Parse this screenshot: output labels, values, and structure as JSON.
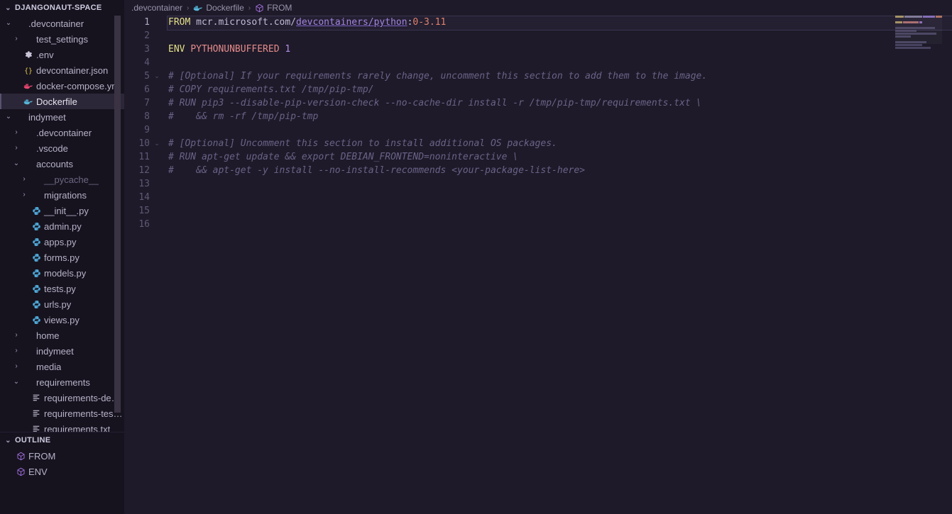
{
  "theme": {
    "sidebar_bg": "#16131f",
    "editor_bg": "#1e1a29",
    "selection_bg": "#2c2738",
    "current_line_bg": "#241f31",
    "accent": "#a285e0",
    "keyword": "#e4e08a",
    "comment": "#6a6388",
    "number": "#e0826e",
    "variable": "#e48c8c",
    "value": "#b48ee8",
    "text": "#b7b2c8"
  },
  "sidebar": {
    "explorer": {
      "header": "DJANGONAUT-SPACE",
      "twisty": "⌄",
      "items": [
        {
          "label": ".devcontainer",
          "depth": 1,
          "twisty": "⌄",
          "icon": "none",
          "selected": false,
          "dim": false
        },
        {
          "label": "test_settings",
          "depth": 2,
          "twisty": "›",
          "icon": "none",
          "selected": false,
          "dim": false
        },
        {
          "label": ".env",
          "depth": 2,
          "twisty": "",
          "icon": "gear-icon",
          "selected": false,
          "dim": false
        },
        {
          "label": "devcontainer.json",
          "depth": 2,
          "twisty": "",
          "icon": "json-icon",
          "selected": false,
          "dim": false
        },
        {
          "label": "docker-compose.yml",
          "depth": 2,
          "twisty": "",
          "icon": "docker-pink-icon",
          "selected": false,
          "dim": false
        },
        {
          "label": "Dockerfile",
          "depth": 2,
          "twisty": "",
          "icon": "docker-blue-icon",
          "selected": true,
          "dim": false
        },
        {
          "label": "indymeet",
          "depth": 1,
          "twisty": "⌄",
          "icon": "none",
          "selected": false,
          "dim": false
        },
        {
          "label": ".devcontainer",
          "depth": 2,
          "twisty": "›",
          "icon": "none",
          "selected": false,
          "dim": false
        },
        {
          "label": ".vscode",
          "depth": 2,
          "twisty": "›",
          "icon": "none",
          "selected": false,
          "dim": false
        },
        {
          "label": "accounts",
          "depth": 2,
          "twisty": "⌄",
          "icon": "none",
          "selected": false,
          "dim": false
        },
        {
          "label": "__pycache__",
          "depth": 3,
          "twisty": "›",
          "icon": "none",
          "selected": false,
          "dim": true
        },
        {
          "label": "migrations",
          "depth": 3,
          "twisty": "›",
          "icon": "none",
          "selected": false,
          "dim": false
        },
        {
          "label": "__init__.py",
          "depth": 3,
          "twisty": "",
          "icon": "python-icon",
          "selected": false,
          "dim": false
        },
        {
          "label": "admin.py",
          "depth": 3,
          "twisty": "",
          "icon": "python-icon",
          "selected": false,
          "dim": false
        },
        {
          "label": "apps.py",
          "depth": 3,
          "twisty": "",
          "icon": "python-icon",
          "selected": false,
          "dim": false
        },
        {
          "label": "forms.py",
          "depth": 3,
          "twisty": "",
          "icon": "python-icon",
          "selected": false,
          "dim": false
        },
        {
          "label": "models.py",
          "depth": 3,
          "twisty": "",
          "icon": "python-icon",
          "selected": false,
          "dim": false
        },
        {
          "label": "tests.py",
          "depth": 3,
          "twisty": "",
          "icon": "python-icon",
          "selected": false,
          "dim": false
        },
        {
          "label": "urls.py",
          "depth": 3,
          "twisty": "",
          "icon": "python-icon",
          "selected": false,
          "dim": false
        },
        {
          "label": "views.py",
          "depth": 3,
          "twisty": "",
          "icon": "python-icon",
          "selected": false,
          "dim": false
        },
        {
          "label": "home",
          "depth": 2,
          "twisty": "›",
          "icon": "none",
          "selected": false,
          "dim": false
        },
        {
          "label": "indymeet",
          "depth": 2,
          "twisty": "›",
          "icon": "none",
          "selected": false,
          "dim": false
        },
        {
          "label": "media",
          "depth": 2,
          "twisty": "›",
          "icon": "none",
          "selected": false,
          "dim": false
        },
        {
          "label": "requirements",
          "depth": 2,
          "twisty": "⌄",
          "icon": "none",
          "selected": false,
          "dim": false
        },
        {
          "label": "requirements-dev.t…",
          "depth": 3,
          "twisty": "",
          "icon": "text-icon",
          "selected": false,
          "dim": false
        },
        {
          "label": "requirements-test.…",
          "depth": 3,
          "twisty": "",
          "icon": "text-icon",
          "selected": false,
          "dim": false
        },
        {
          "label": "requirements.txt",
          "depth": 3,
          "twisty": "",
          "icon": "text-icon",
          "selected": false,
          "dim": false
        }
      ]
    },
    "outline": {
      "header": "OUTLINE",
      "twisty": "⌄",
      "items": [
        {
          "label": "FROM",
          "icon": "symbol-cube-icon"
        },
        {
          "label": "ENV",
          "icon": "symbol-cube-icon"
        }
      ]
    }
  },
  "breadcrumb": {
    "items": [
      {
        "label": ".devcontainer",
        "icon": "none"
      },
      {
        "label": "Dockerfile",
        "icon": "docker-blue-icon"
      },
      {
        "label": "FROM",
        "icon": "symbol-cube-icon"
      }
    ],
    "separator": "›"
  },
  "editor": {
    "filename": "Dockerfile",
    "lines": [
      {
        "n": "1",
        "fold": "",
        "current": true,
        "tokens": [
          {
            "t": "FROM",
            "c": "t-kw"
          },
          {
            "t": " mcr.microsoft.com/",
            "c": "t-str"
          },
          {
            "t": "devcontainers/python",
            "c": "t-link"
          },
          {
            "t": ":",
            "c": "t-str"
          },
          {
            "t": "0-3.11",
            "c": "t-num"
          }
        ]
      },
      {
        "n": "2",
        "fold": "",
        "current": false,
        "tokens": []
      },
      {
        "n": "3",
        "fold": "",
        "current": false,
        "tokens": [
          {
            "t": "ENV",
            "c": "t-kw"
          },
          {
            "t": " ",
            "c": "t-str"
          },
          {
            "t": "PYTHONUNBUFFERED",
            "c": "t-var"
          },
          {
            "t": " ",
            "c": "t-str"
          },
          {
            "t": "1",
            "c": "t-val"
          }
        ]
      },
      {
        "n": "4",
        "fold": "",
        "current": false,
        "tokens": []
      },
      {
        "n": "5",
        "fold": "⌄",
        "current": false,
        "tokens": [
          {
            "t": "# [Optional] If your requirements rarely change, uncomment this section to add them to the image.",
            "c": "t-cmt"
          }
        ]
      },
      {
        "n": "6",
        "fold": "",
        "current": false,
        "tokens": [
          {
            "t": "# COPY requirements.txt /tmp/pip-tmp/",
            "c": "t-cmt"
          }
        ]
      },
      {
        "n": "7",
        "fold": "",
        "current": false,
        "tokens": [
          {
            "t": "# RUN pip3 --disable-pip-version-check --no-cache-dir install -r /tmp/pip-tmp/requirements.txt \\",
            "c": "t-cmt"
          }
        ]
      },
      {
        "n": "8",
        "fold": "",
        "current": false,
        "tokens": [
          {
            "t": "#    && rm -rf /tmp/pip-tmp",
            "c": "t-cmt"
          }
        ]
      },
      {
        "n": "9",
        "fold": "",
        "current": false,
        "tokens": []
      },
      {
        "n": "10",
        "fold": "⌄",
        "current": false,
        "tokens": [
          {
            "t": "# [Optional] Uncomment this section to install additional OS packages.",
            "c": "t-cmt"
          }
        ]
      },
      {
        "n": "11",
        "fold": "",
        "current": false,
        "tokens": [
          {
            "t": "# RUN apt-get update && export DEBIAN_FRONTEND=noninteractive \\",
            "c": "t-cmt"
          }
        ]
      },
      {
        "n": "12",
        "fold": "",
        "current": false,
        "tokens": [
          {
            "t": "#    && apt-get -y install --no-install-recommends <your-package-list-here>",
            "c": "t-cmt"
          }
        ]
      },
      {
        "n": "13",
        "fold": "",
        "current": false,
        "tokens": []
      },
      {
        "n": "14",
        "fold": "",
        "current": false,
        "tokens": []
      },
      {
        "n": "15",
        "fold": "",
        "current": false,
        "tokens": []
      },
      {
        "n": "16",
        "fold": "",
        "current": false,
        "tokens": []
      }
    ]
  },
  "minimap": {
    "rows": [
      [
        {
          "w": 12,
          "c": "#b9a56a"
        },
        {
          "w": 26,
          "c": "#8d86a6"
        },
        {
          "w": 18,
          "c": "#8f76cc"
        },
        {
          "w": 9,
          "c": "#c07c66"
        }
      ],
      [],
      [
        {
          "w": 10,
          "c": "#b9a56a"
        },
        {
          "w": 22,
          "c": "#c07878"
        },
        {
          "w": 4,
          "c": "#9b7ad0"
        }
      ],
      [],
      [
        {
          "w": 56,
          "c": "#4f4a68"
        }
      ],
      [
        {
          "w": 30,
          "c": "#4f4a68"
        }
      ],
      [
        {
          "w": 58,
          "c": "#4f4a68"
        }
      ],
      [
        {
          "w": 22,
          "c": "#4f4a68"
        }
      ],
      [],
      [
        {
          "w": 44,
          "c": "#4f4a68"
        }
      ],
      [
        {
          "w": 38,
          "c": "#4f4a68"
        }
      ],
      [
        {
          "w": 50,
          "c": "#4f4a68"
        }
      ]
    ]
  }
}
